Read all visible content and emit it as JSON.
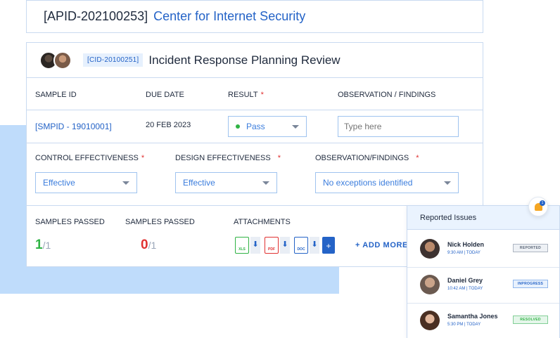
{
  "header": {
    "apid": "[APID-202100253]",
    "name": "Center for Internet Security"
  },
  "review": {
    "cid": "[CID-20100251]",
    "title": "Incident Response Planning Review"
  },
  "columns": {
    "sample_id": "SAMPLE ID",
    "due_date": "DUE DATE",
    "result": "RESULT",
    "observation": "OBSERVATION / FINDINGS",
    "required_mark": "*"
  },
  "sample_row": {
    "sample_id": "[SMPID - 19010001]",
    "due_date": "20 FEB 2023",
    "result": "Pass",
    "observation_placeholder": "Type here"
  },
  "effectiveness": {
    "control_label": "CONTROL EFFECTIVENESS",
    "control_value": "Effective",
    "design_label": "DESIGN EFFECTIVENESS",
    "design_value": "Effective",
    "observation_label": "OBSERVATION/FINDINGS",
    "observation_value": "No exceptions identified"
  },
  "samples": {
    "passed_label_1": "SAMPLES PASSED",
    "passed_value_1": "1",
    "passed_total_1": "/1",
    "passed_label_2": "SAMPLES PASSED",
    "passed_value_2": "0",
    "passed_total_2": "/1",
    "attachments_label": "ATTACHMENTS",
    "files": [
      "XLS",
      "PDF",
      "DOC"
    ],
    "add_more": "+ ADD MORE"
  },
  "issues": {
    "title": "Reported Issues",
    "badge_count": "1",
    "items": [
      {
        "name": "Nick Holden",
        "time": "9:30 AM | TODAY",
        "status": "REPORTED"
      },
      {
        "name": "Daniel Grey",
        "time": "10:42 AM | TODAY",
        "status": "INPROGRESS"
      },
      {
        "name": "Samantha Jones",
        "time": "5:30 PM | TODAY",
        "status": "RESOLVED"
      }
    ]
  },
  "colors": {
    "accent": "#2463c7",
    "pass": "#2fb344",
    "fail": "#e03131",
    "warning": "#f5a623"
  }
}
